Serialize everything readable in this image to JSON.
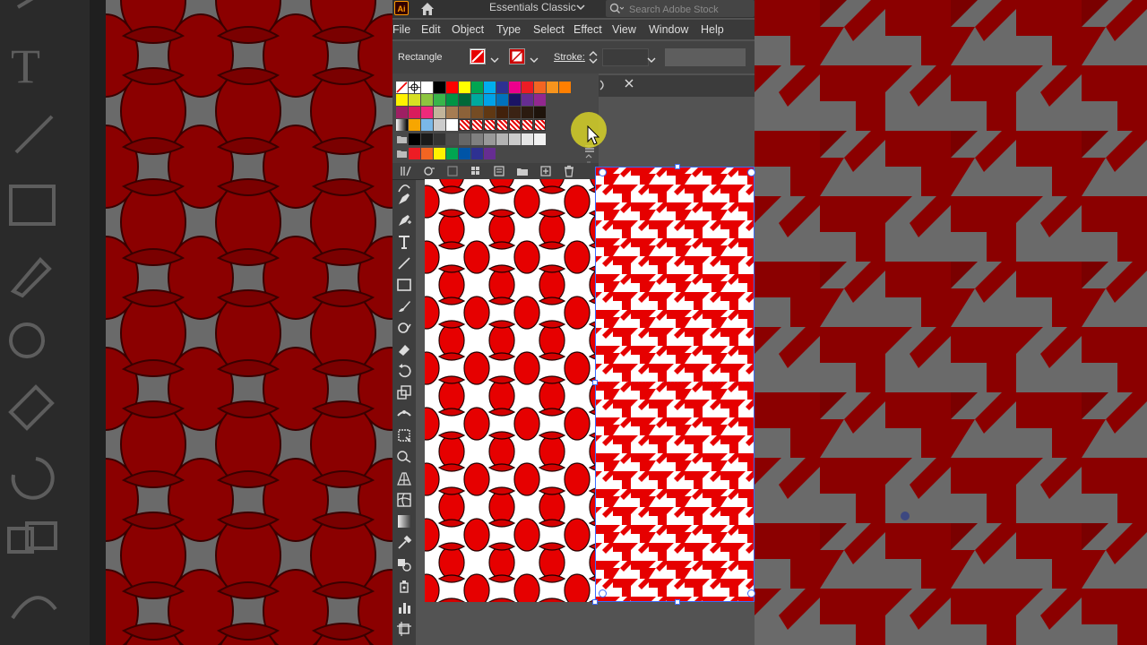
{
  "app": {
    "logo": "Ai",
    "workspace": "Essentials Classic",
    "search_placeholder": "Search Adobe Stock"
  },
  "menu": [
    "File",
    "Edit",
    "Object",
    "Type",
    "Select",
    "Effect",
    "View",
    "Window",
    "Help"
  ],
  "control": {
    "selection_type": "Rectangle",
    "stroke_label": "Stroke:",
    "stroke_value": ""
  },
  "colors": {
    "ui_dark": "#323232",
    "ui_panel": "#484848",
    "canvas": "#535353",
    "pattern_red": "#e60000",
    "selection_blue": "#3b6cff",
    "cursor_halo": "#d6d128"
  },
  "swatch_rows": [
    [
      "none",
      "registration",
      "#ffffff",
      "#000000",
      "#ff0000",
      "#ffff00",
      "#00a651",
      "#00aeef",
      "#2e3192",
      "#ec008c",
      "#ed1c24",
      "#f26522",
      "#f7941d",
      "#ff7f00"
    ],
    [
      "#fff200",
      "#d7df23",
      "#8dc63f",
      "#39b54a",
      "#009444",
      "#006838",
      "#00a99d",
      "#00a2e8",
      "#0072bc",
      "#1b1464",
      "#662d91",
      "#92278f"
    ],
    [
      "#9e1f63",
      "#d91c5c",
      "#ee2a7b",
      "#c2b59b",
      "#a67c52",
      "#8c6239",
      "#754c24",
      "#603813",
      "#42210b",
      "#3b2314",
      "#2b1b10",
      "#1e130b"
    ],
    [
      "gradient",
      "#f7a600",
      "#7ab8e8",
      "#cccccc",
      "#ffffff",
      "pattern",
      "pattern",
      "pattern",
      "pattern",
      "pattern",
      "pattern",
      "pattern"
    ],
    [
      "folder",
      "#000000",
      "#1a1a1a",
      "#333333",
      "#4d4d4d",
      "#666666",
      "#808080",
      "#999999",
      "#b3b3b3",
      "#cccccc",
      "#e6e6e6",
      "#f2f2f2"
    ],
    [
      "folder",
      "#ed1c24",
      "#f26522",
      "#fff200",
      "#00a651",
      "#0054a6",
      "#2e3192",
      "#662d91"
    ]
  ],
  "icons": {
    "home": "home-icon",
    "search": "search-icon",
    "close_tab": "close-icon"
  }
}
